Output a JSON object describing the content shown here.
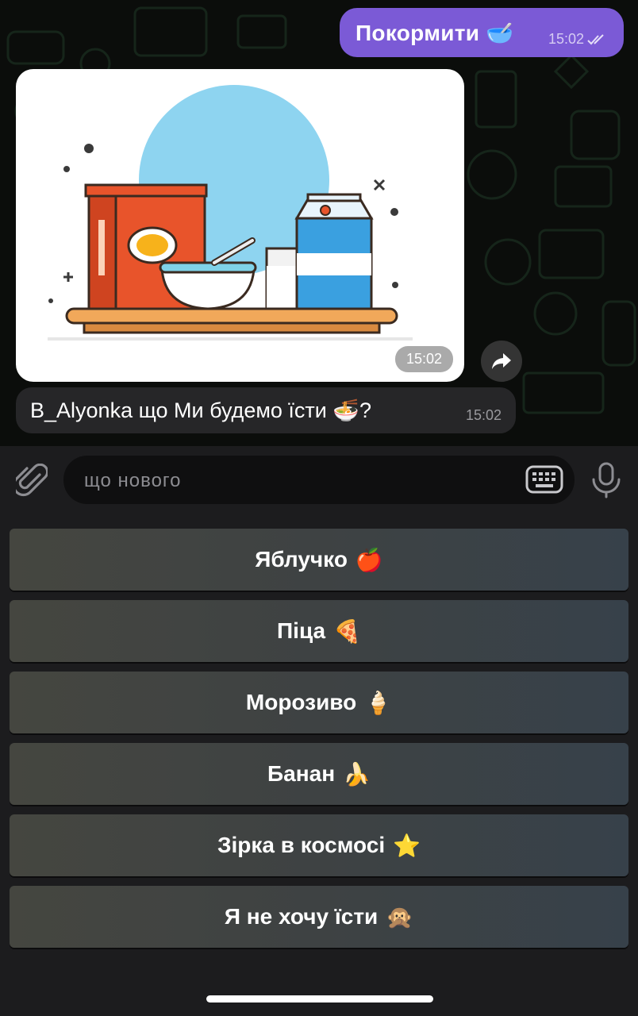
{
  "messages": {
    "outgoing": {
      "text": "Покормити 🥣",
      "time": "15:02",
      "status_icon": "double-check-icon"
    },
    "photo": {
      "time": "15:02"
    },
    "incoming": {
      "text": "B_Alyonka що Ми будемо їсти 🍜?",
      "time": "15:02"
    }
  },
  "input": {
    "placeholder": "що нового"
  },
  "keyboard": {
    "buttons": [
      {
        "label": "Яблучко",
        "emoji": "🍎"
      },
      {
        "label": "Піца",
        "emoji": "🍕"
      },
      {
        "label": "Морозиво",
        "emoji": "🍦"
      },
      {
        "label": "Банан",
        "emoji": "🍌"
      },
      {
        "label": "Зірка в космосі",
        "emoji": "⭐"
      },
      {
        "label": "Я не хочу їсти",
        "emoji": "🙊"
      }
    ]
  },
  "colors": {
    "outgoing_bubble": "#7b5ad6",
    "incoming_bubble": "#262628",
    "background": "#0b0d0b",
    "doodle": "#1f3a28"
  }
}
